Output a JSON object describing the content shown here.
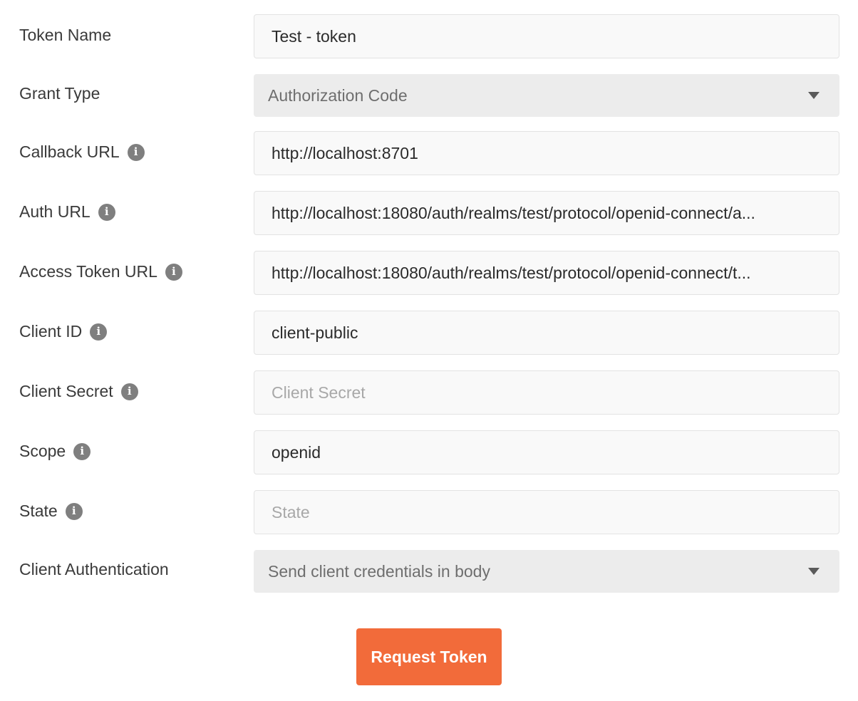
{
  "fields": [
    {
      "label": "Token Name",
      "value": "Test - token",
      "placeholder": "",
      "info": false,
      "type": "input"
    },
    {
      "label": "Grant Type",
      "value": "Authorization Code",
      "info": false,
      "type": "select"
    },
    {
      "label": "Callback URL",
      "value": "http://localhost:8701",
      "placeholder": "",
      "info": true,
      "type": "input"
    },
    {
      "label": "Auth URL",
      "value": "http://localhost:18080/auth/realms/test/protocol/openid-connect/a...",
      "placeholder": "",
      "info": true,
      "type": "input"
    },
    {
      "label": "Access Token URL",
      "value": "http://localhost:18080/auth/realms/test/protocol/openid-connect/t...",
      "placeholder": "",
      "info": true,
      "type": "input"
    },
    {
      "label": "Client ID",
      "value": "client-public",
      "placeholder": "",
      "info": true,
      "type": "input"
    },
    {
      "label": "Client Secret",
      "value": "",
      "placeholder": "Client Secret",
      "info": true,
      "type": "input"
    },
    {
      "label": "Scope",
      "value": "openid",
      "placeholder": "",
      "info": true,
      "type": "input"
    },
    {
      "label": "State",
      "value": "",
      "placeholder": "State",
      "info": true,
      "type": "input"
    },
    {
      "label": "Client Authentication",
      "value": "Send client credentials in body",
      "info": false,
      "type": "select"
    }
  ],
  "info_icon_glyph": "i",
  "request_button_label": "Request Token",
  "colors": {
    "accent": "#f26b3a",
    "info_icon": "#7f7f7f"
  }
}
